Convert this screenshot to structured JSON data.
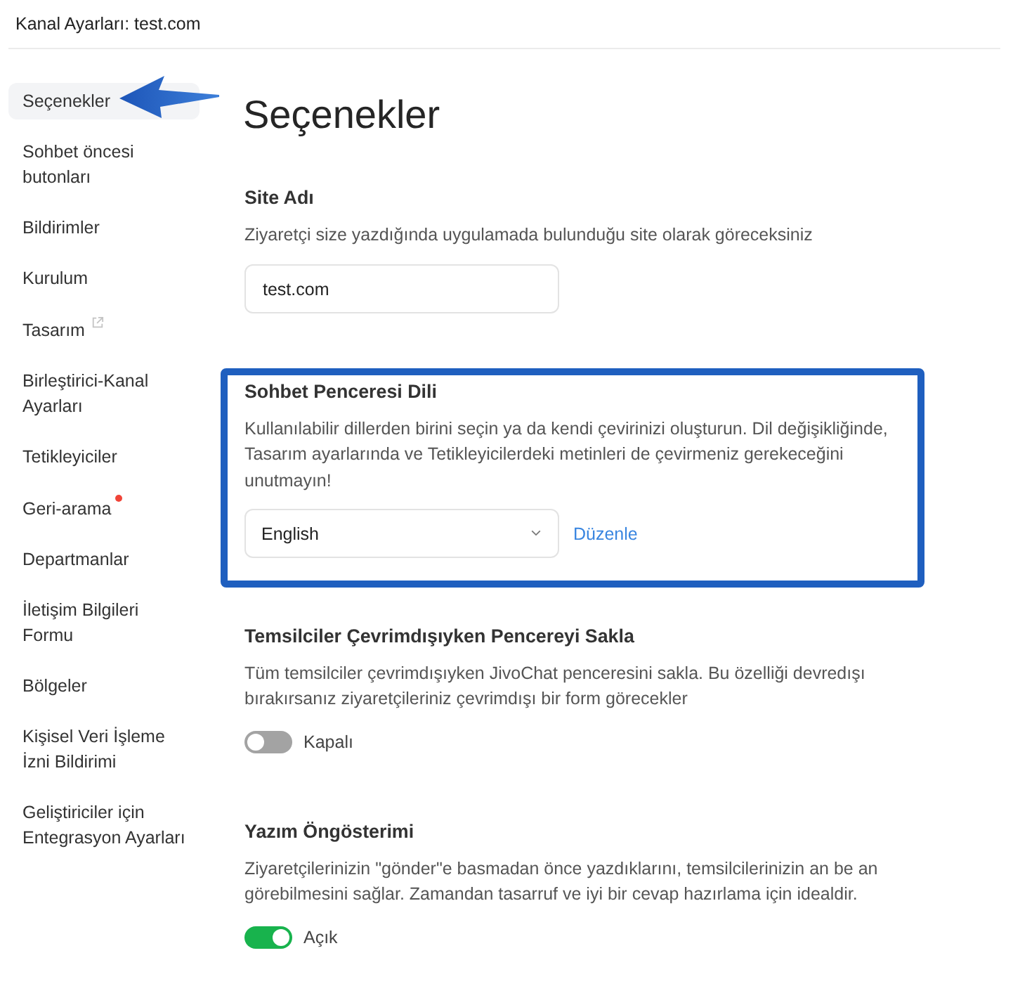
{
  "window": {
    "title": "Kanal Ayarları: test.com"
  },
  "sidebar": {
    "items": [
      {
        "label": "Seçenekler",
        "selected": true,
        "kind": "page",
        "arrow": true
      },
      {
        "label": "Sohbet öncesi butonları",
        "selected": false,
        "kind": "page",
        "arrow": false
      },
      {
        "label": "Bildirimler",
        "selected": false,
        "kind": "page",
        "arrow": false
      },
      {
        "label": "Kurulum",
        "selected": false,
        "kind": "page",
        "arrow": false
      },
      {
        "label": "Tasarım",
        "selected": false,
        "kind": "external",
        "arrow": false
      },
      {
        "label": "Birleştirici-Kanal Ayarları",
        "selected": false,
        "kind": "page",
        "arrow": false
      },
      {
        "label": "Tetikleyiciler",
        "selected": false,
        "kind": "page",
        "arrow": false
      },
      {
        "label": "Geri-arama",
        "selected": false,
        "kind": "alert",
        "arrow": false
      },
      {
        "label": "Departmanlar",
        "selected": false,
        "kind": "page",
        "arrow": false
      },
      {
        "label": "İletişim Bilgileri Formu",
        "selected": false,
        "kind": "page",
        "arrow": false
      },
      {
        "label": "Bölgeler",
        "selected": false,
        "kind": "page",
        "arrow": false
      },
      {
        "label": "Kişisel Veri İşleme İzni Bildirimi",
        "selected": false,
        "kind": "page",
        "arrow": false
      },
      {
        "label": "Geliştiriciler için Entegrasyon Ayarları",
        "selected": false,
        "kind": "page",
        "arrow": false
      }
    ]
  },
  "page": {
    "heading": "Seçenekler",
    "sections": [
      {
        "kind": "text_field",
        "title": "Site Adı",
        "description": "Ziyaretçi size yazdığında uygulamada bulunduğu site olarak göreceksiniz",
        "value": "test.com",
        "highlighted": false
      },
      {
        "kind": "select",
        "title": "Sohbet Penceresi Dili",
        "description": "Kullanılabilir dillerden birini seçin ya da kendi çevirinizi oluşturun. Dil değişikliğinde, Tasarım ayarlarında ve Tetikleyicilerdeki metinleri de çevirmeniz gerekeceğini unutmayın!",
        "value": "English",
        "link": "Düzenle",
        "highlighted": true
      },
      {
        "kind": "toggle",
        "title": "Temsilciler Çevrimdışıyken Pencereyi Sakla",
        "description": "Tüm temsilciler çevrimdışıyken JivoChat penceresini sakla. Bu özelliği devredışı bırakırsanız ziyaretçileriniz çevrimdışı bir form görecekler",
        "on": false,
        "state_label": "Kapalı",
        "highlighted": false
      },
      {
        "kind": "toggle",
        "title": "Yazım Öngösterimi",
        "description": "Ziyaretçilerinizin \"gönder\"e basmadan önce yazdıklarını, temsilcilerinizin an be an görebilmesini sağlar. Zamandan tasarruf ve iyi bir cevap hazırlama için idealdir.",
        "on": true,
        "state_label": "Açık",
        "highlighted": false
      }
    ]
  }
}
